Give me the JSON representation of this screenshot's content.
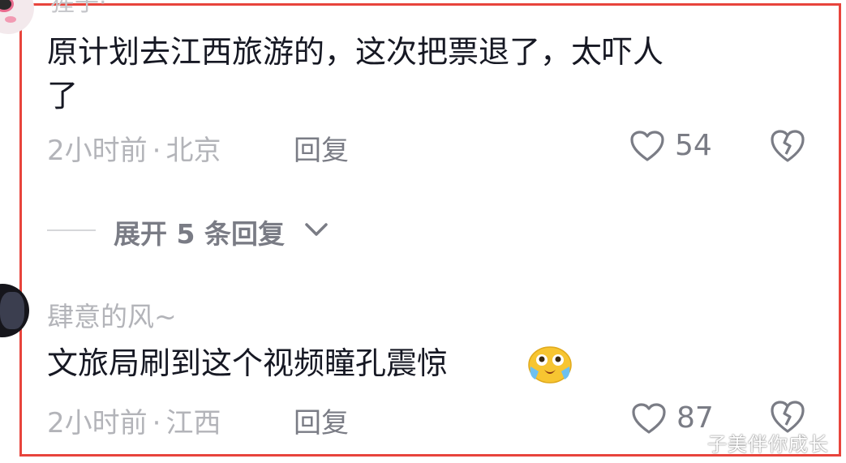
{
  "comments": [
    {
      "username_partial": "猩子·",
      "text_line1": "原计划去江西旅游的，这次把票退了，太吓人",
      "text_line2": "了",
      "time": "2小时前",
      "location": "北京",
      "reply_label": "回复",
      "like_count": "54"
    },
    {
      "username": "肆意的风~",
      "text": "文旅局刷到这个视频瞳孔震惊",
      "time": "2小时前",
      "location": "江西",
      "reply_label": "回复",
      "like_count": "87"
    }
  ],
  "expand_replies": {
    "label": "展开 5 条回复"
  },
  "meta_separator": "·",
  "watermark": "子美伴你成长",
  "colors": {
    "highlight_border": "#e8443c",
    "text_primary": "#161823",
    "text_secondary": "#b3b4b9"
  }
}
